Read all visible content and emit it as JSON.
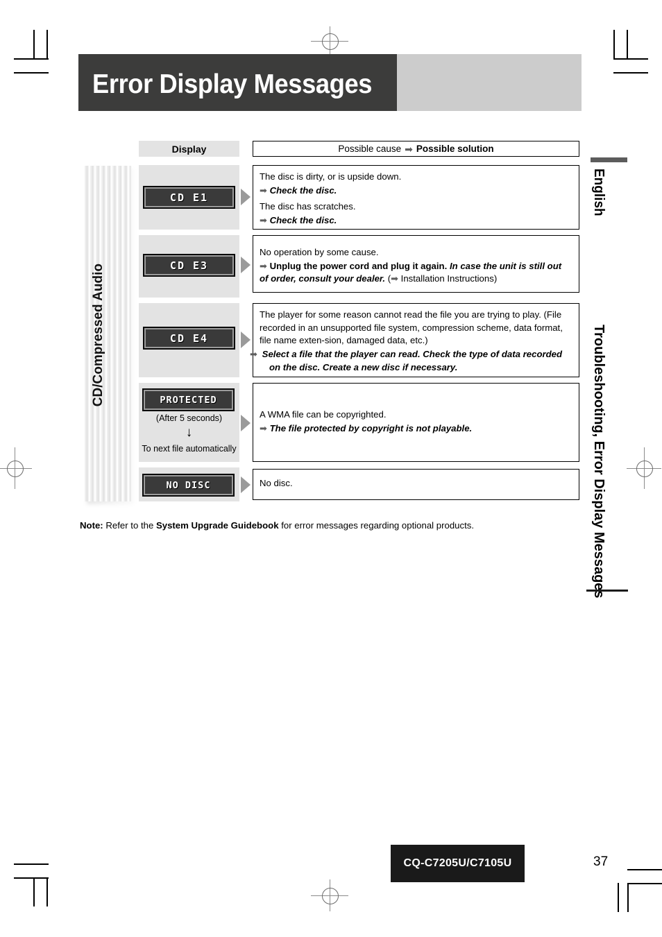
{
  "header": {
    "title": "Error Display Messages"
  },
  "side": {
    "english": "English",
    "section": "Troubleshooting, Error Display Messages",
    "category": "CD/Compressed Audio"
  },
  "table": {
    "col_display_header": "Display",
    "col_cause_header_plain": "Possible cause",
    "col_cause_header_bold": "Possible solution",
    "arrow_glyph": "➡",
    "rows": [
      {
        "display_code": "CD  E1",
        "lines": [
          {
            "text": "The disc is dirty, or is upside down.",
            "style": "plain"
          },
          {
            "text": "Check the disc.",
            "style": "solution"
          },
          {
            "text": "The disc has scratches.",
            "style": "plain"
          },
          {
            "text": "Check the disc.",
            "style": "solution"
          }
        ]
      },
      {
        "display_code": "CD  E3",
        "lines": [
          {
            "text": "No operation by some cause.",
            "style": "plain"
          },
          {
            "text": "Unplug the power cord and plug it again.",
            "style": "solution-bold",
            "emph": "In case the unit is still out of order, consult your dealer.",
            "tail": "Installation Instructions"
          }
        ]
      },
      {
        "display_code": "CD  E4",
        "lines": [
          {
            "text": "The player for some reason cannot read the file you are trying to play. (File recorded in an unsupported file system, compression scheme, data format, file name exten-sion, damaged data, etc.)",
            "style": "plain"
          },
          {
            "text": "Select a file that the player can read. Check the type of data recorded on the disc. Create a new disc if necessary.",
            "style": "solution"
          }
        ]
      },
      {
        "display_code": "PROTECTED",
        "sub_note": "(After 5 seconds)",
        "sub_arrow": "↓",
        "sub_note2": "To next file automatically",
        "lines": [
          {
            "text": "A WMA file can be copyrighted.",
            "style": "plain"
          },
          {
            "text": "The file protected by copyright is not playable.",
            "style": "solution"
          }
        ]
      },
      {
        "display_code": "NO DISC",
        "lines": [
          {
            "text": "No disc.",
            "style": "plain"
          }
        ]
      }
    ]
  },
  "note": {
    "label": "Note:",
    "before": " Refer to the ",
    "bold": "System Upgrade Guidebook",
    "after": " for error messages regarding optional products."
  },
  "footer": {
    "model": "CQ-C7205U/C7105U",
    "page_number": "37"
  },
  "colors": {
    "header_dark": "#3c3c3b",
    "header_grey": "#cccccc",
    "cell_grey": "#e3e3e3",
    "lcd_face": "#3a3a3a",
    "triangle": "#9a9a9a",
    "footer_black": "#1a1a1a"
  }
}
